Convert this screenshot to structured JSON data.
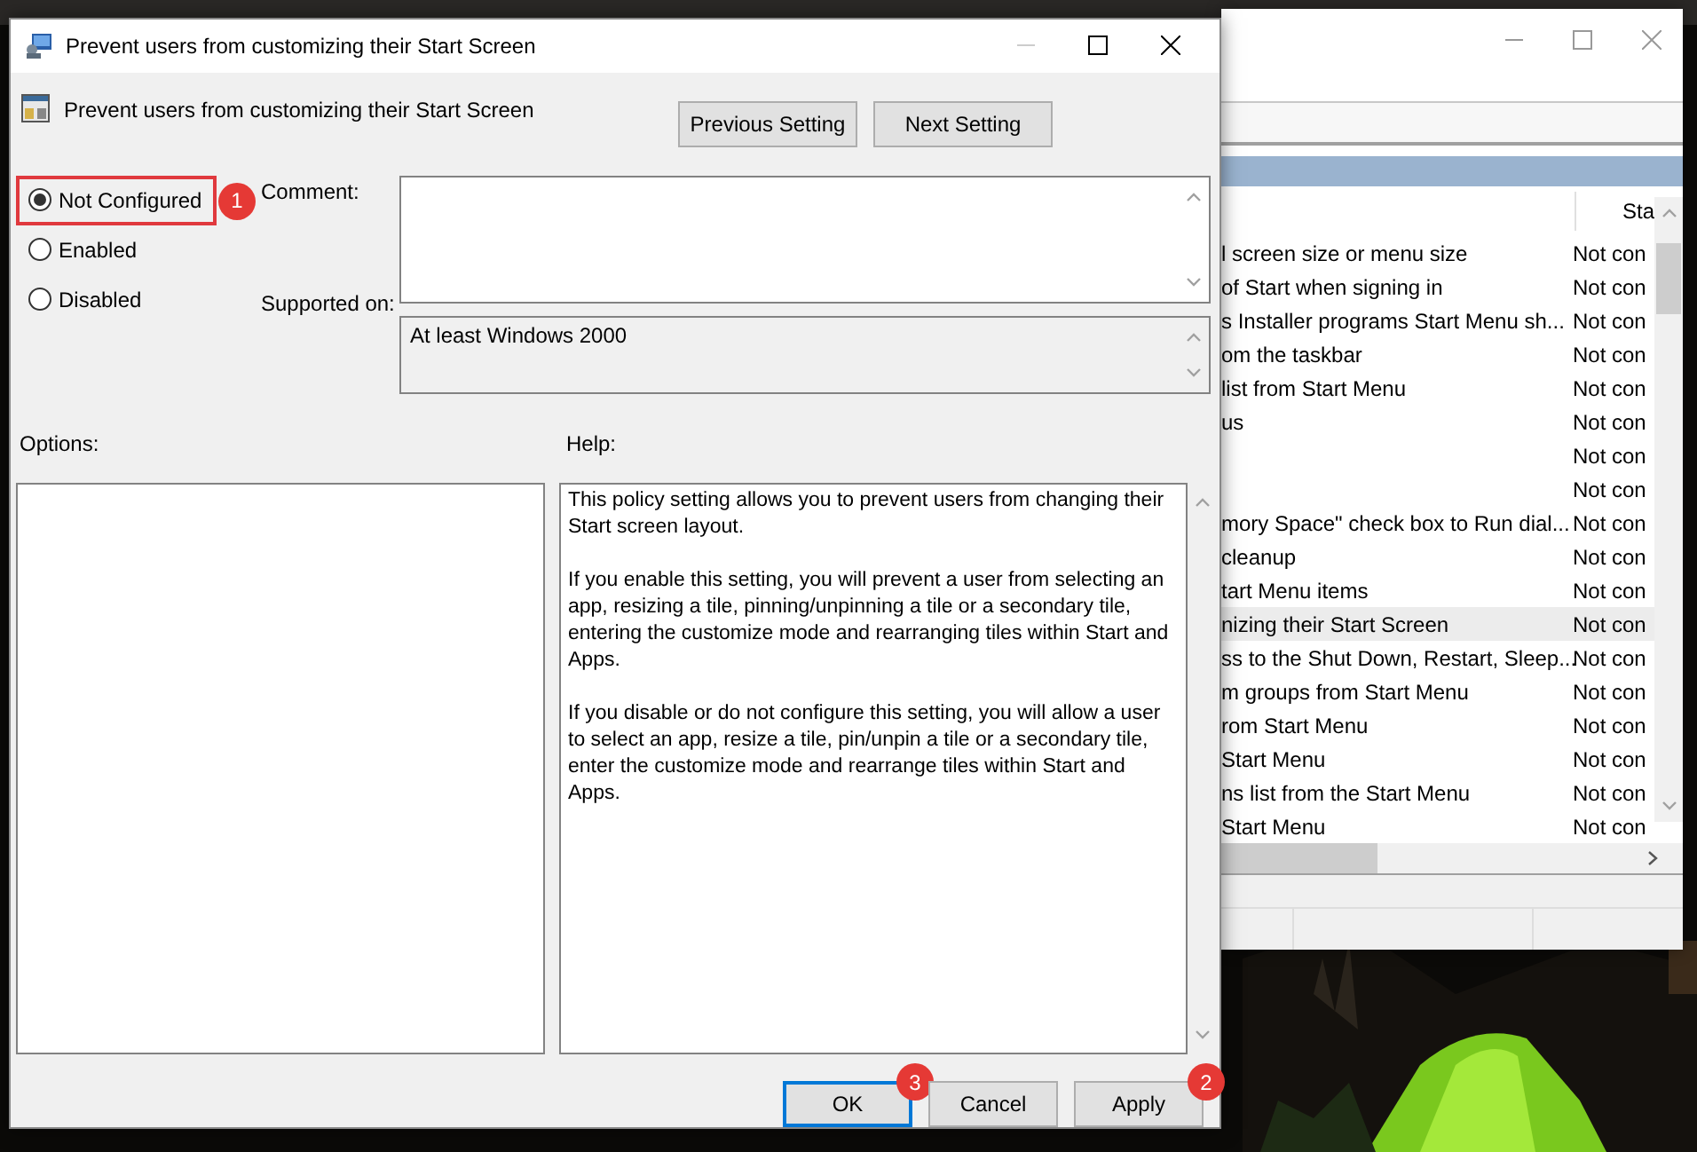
{
  "dialog": {
    "title": "Prevent users from customizing their Start Screen",
    "policy_name": "Prevent users from customizing their Start Screen",
    "nav_buttons": [
      {
        "label": "Previous Setting"
      },
      {
        "label": "Next Setting"
      }
    ],
    "state_options": [
      {
        "label": "Not Configured",
        "selected": true,
        "highlighted": true,
        "badge": "1"
      },
      {
        "label": "Enabled",
        "selected": false,
        "highlighted": false
      },
      {
        "label": "Disabled",
        "selected": false,
        "highlighted": false
      }
    ],
    "comment": {
      "label": "Comment:"
    },
    "supported_on": {
      "label": "Supported on:",
      "value": "At least Windows 2000"
    },
    "options_label": "Options:",
    "help_label": "Help:",
    "help_text": [
      "This policy setting allows you to prevent users from changing their Start screen layout.",
      "If you enable this setting, you will prevent a user from selecting an app, resizing a tile, pinning/unpinning a tile or a secondary tile, entering the customize mode and rearranging tiles within Start and Apps.",
      "If you disable or do not configure this setting, you will allow a user to select an app, resize a tile, pin/unpin a tile or a secondary tile, enter the customize mode and rearrange tiles within Start and Apps."
    ],
    "buttons": [
      {
        "label": "OK",
        "default": true,
        "badge": "3"
      },
      {
        "label": "Cancel",
        "default": false
      },
      {
        "label": "Apply",
        "default": false,
        "badge": "2"
      }
    ]
  },
  "background_window": {
    "column_header": "Sta",
    "rows": [
      {
        "setting": "l screen size or menu size",
        "state": "Not con",
        "selected": false
      },
      {
        "setting": "of Start when signing in",
        "state": "Not con",
        "selected": false
      },
      {
        "setting": "s Installer programs Start Menu sh...",
        "state": "Not con",
        "selected": false
      },
      {
        "setting": "om the taskbar",
        "state": "Not con",
        "selected": false
      },
      {
        "setting": "list from Start Menu",
        "state": "Not con",
        "selected": false
      },
      {
        "setting": "us",
        "state": "Not con",
        "selected": false
      },
      {
        "state": "Not con",
        "selected": false
      },
      {
        "state": "Not con",
        "selected": false
      },
      {
        "setting": "mory Space\" check box to Run dial...",
        "state": "Not con",
        "selected": false
      },
      {
        "setting": "cleanup",
        "state": "Not con",
        "selected": false
      },
      {
        "setting": "tart Menu items",
        "state": "Not con",
        "selected": false
      },
      {
        "setting": "nizing their Start Screen",
        "state": "Not con",
        "selected": true
      },
      {
        "setting": "ss to the Shut Down, Restart, Sleep...",
        "state": "Not con",
        "selected": false
      },
      {
        "setting": "m groups from Start Menu",
        "state": "Not con",
        "selected": false
      },
      {
        "setting": "rom Start Menu",
        "state": "Not con",
        "selected": false
      },
      {
        "setting": "Start Menu",
        "state": "Not con",
        "selected": false
      },
      {
        "setting": "ns list from the Start Menu",
        "state": "Not con",
        "selected": false
      },
      {
        "setting": "Start Menu",
        "state": "Not con",
        "selected": false
      }
    ]
  }
}
